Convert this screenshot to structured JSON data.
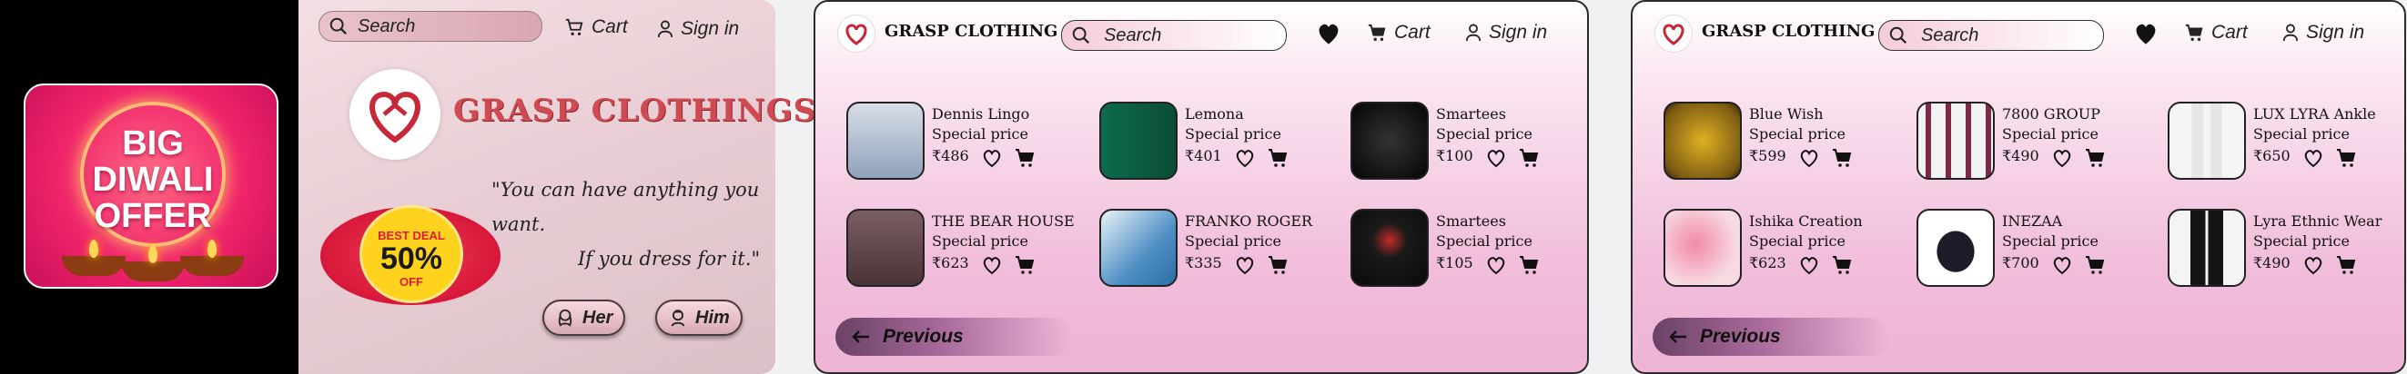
{
  "home": {
    "search_placeholder": "Search",
    "cart_label": "Cart",
    "signin_label": "Sign in",
    "brand": "GRASP CLOTHINGS",
    "quote_line1": "\"You can have anything you want.",
    "quote_line2": "If you dress for it.\"",
    "promo": {
      "line1": "BIG",
      "line2": "DIWALI",
      "line3": "OFFER"
    },
    "deal": {
      "top": "BEST DEAL",
      "percent": "50%",
      "off": "OFF"
    },
    "her_label": "Her",
    "him_label": "Him",
    "colors": {
      "brand_red": "#d04a52",
      "promo_pink": "#f0246a",
      "deal_yellow": "#ffd21e"
    }
  },
  "shop_him": {
    "brand": "GRASP CLOTHING",
    "search_placeholder": "Search",
    "cart_label": "Cart",
    "signin_label": "Sign in",
    "previous_label": "Previous",
    "products": [
      {
        "name": "Dennis Lingo",
        "tag": "Special price",
        "price": "₹486",
        "img": "shirt-white"
      },
      {
        "name": "Lemona",
        "tag": "Special price",
        "price": "₹401",
        "img": "jeans-dark"
      },
      {
        "name": "Smartees",
        "tag": "Special price",
        "price": "₹100",
        "img": "tshirt-black"
      },
      {
        "name": "THE BEAR HOUSE",
        "tag": "Special price",
        "price": "₹623",
        "img": "shirt-check"
      },
      {
        "name": "FRANKO ROGER",
        "tag": "Special price",
        "price": "₹335",
        "img": "jeans-blue"
      },
      {
        "name": "Smartees",
        "tag": "Special price",
        "price": "₹105",
        "img": "tshirt-boys"
      }
    ]
  },
  "shop_her": {
    "brand": "GRASP CLOTHING",
    "search_placeholder": "Search",
    "cart_label": "Cart",
    "signin_label": "Sign in",
    "previous_label": "Previous",
    "products": [
      {
        "name": "Blue Wish",
        "tag": "Special price",
        "price": "₹599",
        "img": "kurta-yellow"
      },
      {
        "name": "7800 GROUP",
        "tag": "Special price",
        "price": "₹490",
        "img": "dress-stripe"
      },
      {
        "name": "LUX LYRA Ankle",
        "tag": "Special price",
        "price": "₹650",
        "img": "leggings-white"
      },
      {
        "name": "Ishika Creation",
        "tag": "Special price",
        "price": "₹623",
        "img": "suit-pink"
      },
      {
        "name": "INEZAA",
        "tag": "Special price",
        "price": "₹700",
        "img": "dress-floral"
      },
      {
        "name": "Lyra Ethnic Wear",
        "tag": "Special price",
        "price": "₹490",
        "img": "leggings-black"
      }
    ]
  }
}
